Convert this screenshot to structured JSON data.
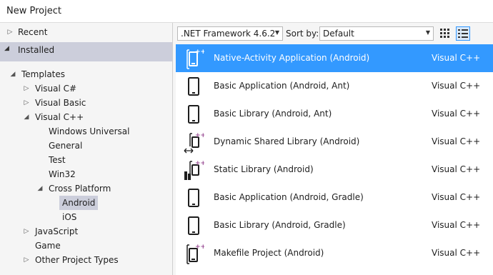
{
  "window": {
    "title": "New Project"
  },
  "tree": {
    "recent": "Recent",
    "installed": "Installed",
    "items": [
      {
        "label": "Templates",
        "toggle": "expanded"
      },
      {
        "label": "Visual C#",
        "toggle": "collapsed"
      },
      {
        "label": "Visual Basic",
        "toggle": "collapsed"
      },
      {
        "label": "Visual C++",
        "toggle": "expanded"
      },
      {
        "label": "Windows Universal",
        "toggle": "none"
      },
      {
        "label": "General",
        "toggle": "none"
      },
      {
        "label": "Test",
        "toggle": "none"
      },
      {
        "label": "Win32",
        "toggle": "none"
      },
      {
        "label": "Cross Platform",
        "toggle": "expanded"
      },
      {
        "label": "Android",
        "toggle": "none",
        "selected": true
      },
      {
        "label": "iOS",
        "toggle": "none"
      },
      {
        "label": "JavaScript",
        "toggle": "collapsed"
      },
      {
        "label": "Game",
        "toggle": "none"
      },
      {
        "label": "Other Project Types",
        "toggle": "collapsed"
      }
    ]
  },
  "toolbar": {
    "framework": ".NET Framework 4.6.2",
    "sort_label": "Sort by:",
    "sort_value": "Default",
    "grid_view_icon": "small-icons-view-icon",
    "list_view_icon": "list-view-icon"
  },
  "templates": [
    {
      "name": "Native-Activity Application (Android)",
      "lang": "Visual C++",
      "icon": "native-activity-icon",
      "selected": true
    },
    {
      "name": "Basic Application (Android, Ant)",
      "lang": "Visual C++",
      "icon": "phone-icon"
    },
    {
      "name": "Basic Library (Android, Ant)",
      "lang": "Visual C++",
      "icon": "phone-icon"
    },
    {
      "name": "Dynamic Shared Library (Android)",
      "lang": "Visual C++",
      "icon": "dynamic-library-icon"
    },
    {
      "name": "Static Library (Android)",
      "lang": "Visual C++",
      "icon": "static-library-icon"
    },
    {
      "name": "Basic Application (Android, Gradle)",
      "lang": "Visual C++",
      "icon": "phone-icon"
    },
    {
      "name": "Basic Library (Android, Gradle)",
      "lang": "Visual C++",
      "icon": "phone-icon"
    },
    {
      "name": "Makefile Project (Android)",
      "lang": "Visual C++",
      "icon": "makefile-icon"
    }
  ],
  "colors": {
    "selection": "#3399ff",
    "tree_selection": "#cccedb",
    "cpp_accent": "#9b4f96"
  }
}
